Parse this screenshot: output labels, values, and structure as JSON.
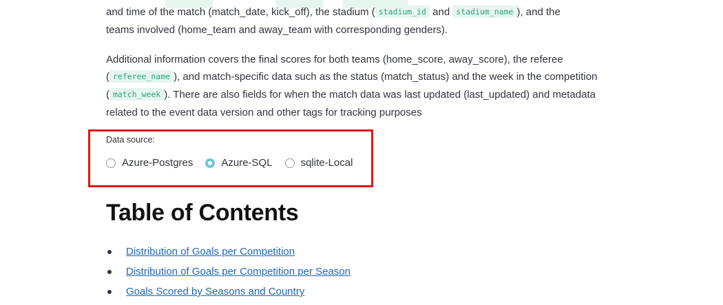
{
  "intro": {
    "line1_pre": "and time of the match (match_date, kick_off), the stadium (",
    "line1_code1": "stadium_id",
    "line1_mid": " and ",
    "line1_code2": "stadium_name",
    "line1_post": "), and the",
    "line2": "teams involved (home_team and away_team with corresponding genders)."
  },
  "details": {
    "text1": "Additional information covers the final scores for both teams (home_score, away_score), the referee (",
    "code1": "referee_name",
    "text2": "), and match-specific data such as the status (match_status) and the week in the competition (",
    "code2": "match_week",
    "text3": "). There are also fields for when the match data was last updated (last_updated) and metadata related to the event data version and other tags for tracking purposes"
  },
  "data_source": {
    "label": "Data source:",
    "options": [
      "Azure-Postgres",
      "Azure-SQL",
      "sqlite-Local"
    ],
    "selected": "Azure-SQL"
  },
  "toc": {
    "title": "Table of Contents",
    "items": [
      "Distribution of Goals per Competition",
      "Distribution of Goals per Competition per Season",
      "Goals Scored by Seasons and Country"
    ]
  },
  "colors": {
    "highlight_border": "#ee1111",
    "link": "#1c65c1",
    "code_text": "#2aa47e",
    "code_bg": "#e6f6ef",
    "radio_selected": "#74c6e3"
  }
}
